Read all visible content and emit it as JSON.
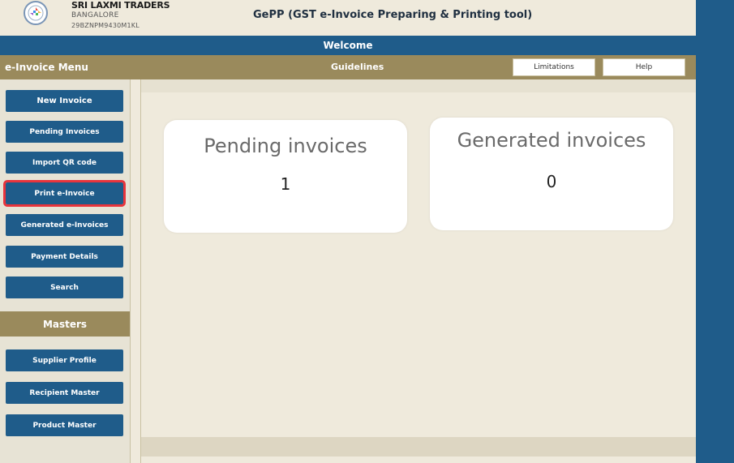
{
  "company": {
    "name": "SRI LAXMI TRADERS",
    "city": "BANGALORE",
    "gstin": "29BZNPM9430M1KL"
  },
  "app": {
    "title": "GePP (GST e-Invoice Preparing & Printing tool)",
    "welcome": "Welcome"
  },
  "menu_bar": {
    "title": "e-Invoice Menu",
    "guidelines": "Guidelines",
    "buttons": [
      "Limitations",
      "Help"
    ]
  },
  "sidebar": {
    "items": [
      {
        "label": "New Invoice",
        "selected": false
      },
      {
        "label": "Pending Invoices",
        "selected": false
      },
      {
        "label": "Import QR code",
        "selected": false
      },
      {
        "label": "Print e-Invoice",
        "selected": true
      },
      {
        "label": "Generated e-Invoices",
        "selected": false
      },
      {
        "label": "Payment Details",
        "selected": false
      },
      {
        "label": "Search",
        "selected": false
      }
    ],
    "masters_title": "Masters",
    "masters": [
      {
        "label": "Supplier Profile"
      },
      {
        "label": "Recipient Master"
      },
      {
        "label": "Product Master"
      }
    ]
  },
  "cards": [
    {
      "title": "Pending invoices",
      "value": "1"
    },
    {
      "title": "Generated invoices",
      "value": "0"
    }
  ],
  "colors": {
    "primary": "#1f5c8a",
    "khaki": "#9a8a5c",
    "background": "#efeadc",
    "selected_outline": "#e8343c"
  }
}
